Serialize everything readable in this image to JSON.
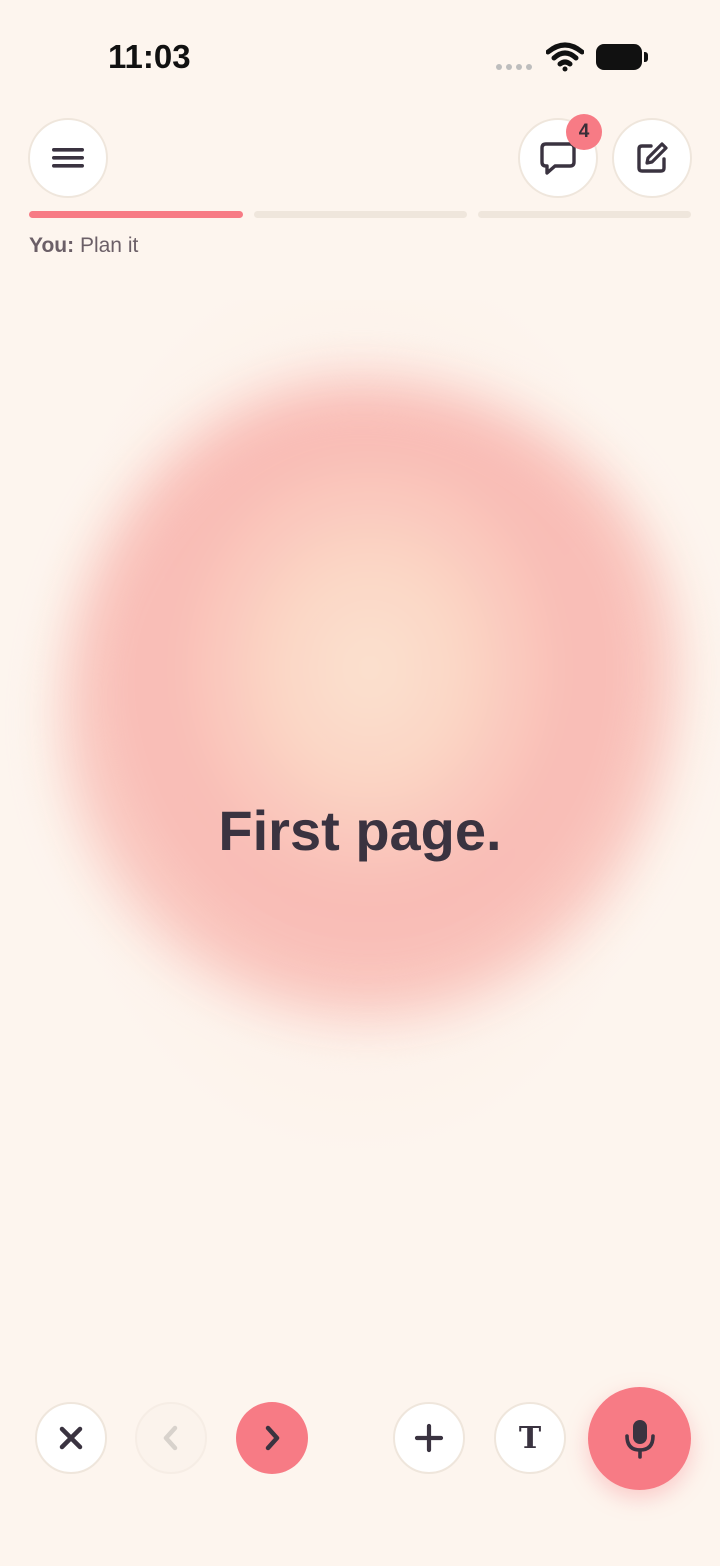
{
  "status_bar": {
    "time": "11:03"
  },
  "header": {
    "menu_icon": "hamburger-menu-icon",
    "chat_icon": "chat-bubble-icon",
    "chat_badge_count": "4",
    "edit_icon": "compose-edit-icon"
  },
  "progress": {
    "segments": 3,
    "active_segment": 1,
    "active_color": "#f77b85",
    "inactive_color": "#efe6dc"
  },
  "conversation": {
    "speaker": "You:",
    "text": "Plan it"
  },
  "main": {
    "headline": "First page."
  },
  "toolbar": {
    "close_icon": "close-x-icon",
    "prev_icon": "chevron-left-icon",
    "next_icon": "chevron-right-icon",
    "add_icon": "plus-icon",
    "text_label": "T",
    "mic_icon": "microphone-icon"
  },
  "colors": {
    "accent": "#f77b85",
    "background": "#fdf5ee",
    "text_dark": "#3a3340"
  }
}
